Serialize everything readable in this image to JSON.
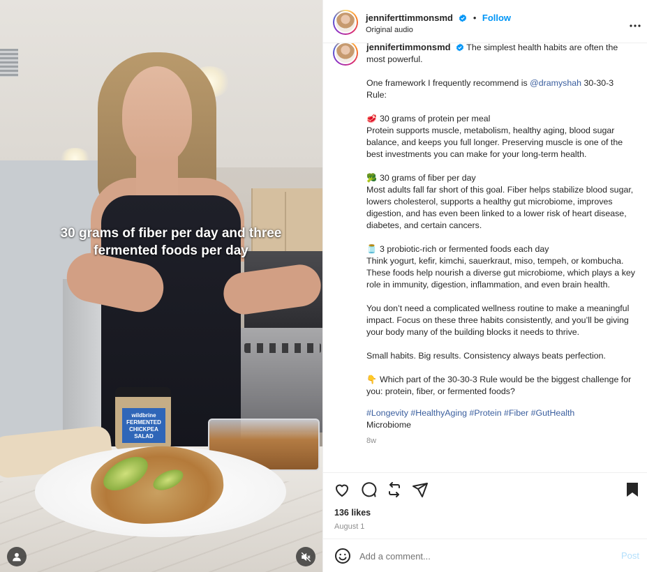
{
  "media": {
    "overlay_text": "30 grams of fiber per day and three fermented foods per day",
    "jar_label": "wildbrine FERMENTED CHICKPEA SALAD"
  },
  "header": {
    "username": "jenniferttimmonsmd",
    "separator": "•",
    "follow_label": "Follow",
    "audio": "Original audio",
    "more_icon": "more-horizontal-icon"
  },
  "caption": {
    "username": "jennifertimmonsmd",
    "intro": "The simplest health habits are often the most powerful.",
    "framework_prefix": "One framework I frequently recommend is ",
    "framework_mention": "@dramyshah",
    "framework_suffix": " 30-30-3 Rule:",
    "protein_title": "30 grams of protein per meal",
    "protein_body": "Protein supports muscle, metabolism, healthy aging, blood sugar balance, and keeps you full longer. Preserving muscle is one of the best investments you can make for your long-term health.",
    "fiber_title": "30 grams of fiber per day",
    "fiber_body": "Most adults fall far short of this goal. Fiber helps stabilize blood sugar, lowers cholesterol, supports a healthy gut microbiome, improves digestion, and has even been linked to a lower risk of heart disease, diabetes, and certain cancers.",
    "probiotic_title": "3 probiotic-rich or fermented foods each day",
    "probiotic_body": "Think yogurt, kefir, kimchi, sauerkraut, miso, tempeh, or kombucha. These foods help nourish a diverse gut microbiome, which plays a key role in immunity, digestion, inflammation, and even brain health.",
    "routine": "You don’t need a complicated wellness routine to make a meaningful impact. Focus on these three habits consistently, and you’ll be giving your body many of the building blocks it needs to thrive.",
    "small_habits": "Small habits. Big results. Consistency always beats perfection.",
    "question": "Which part of the 30-30-3 Rule would be the biggest challenge for you: protein, fiber, or fermented foods?",
    "hashtags": [
      "#Longevity",
      "#HealthyAging",
      "#Protein",
      "#Fiber",
      "#GutHealth"
    ],
    "last_word": "Microbiome",
    "time_ago": "8w"
  },
  "actions": {
    "likes": "136 likes",
    "date": "August 1"
  },
  "comment": {
    "placeholder": "Add a comment...",
    "post_label": "Post"
  },
  "colors": {
    "accent": "#0095f6",
    "hashtag": "#3a5e9e",
    "muted": "#8e8e8e",
    "post_disabled": "#b2dffc"
  }
}
